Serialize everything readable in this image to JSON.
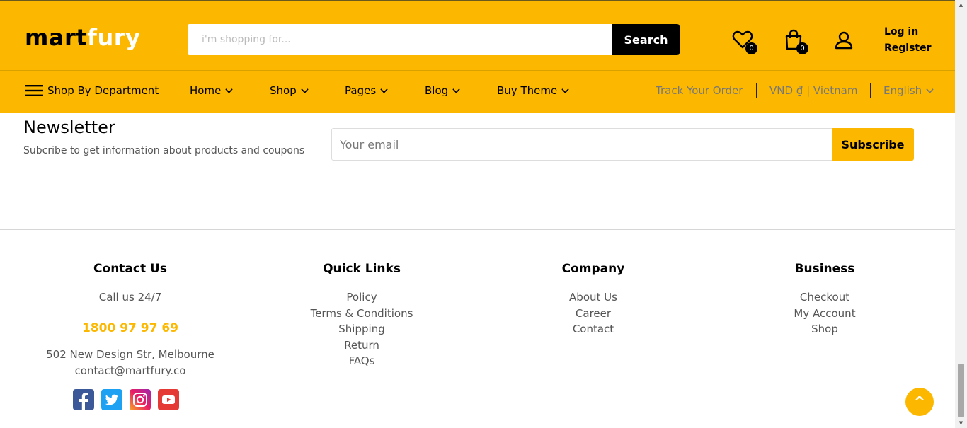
{
  "header": {
    "logo_part1": "mart",
    "logo_part2": "fury",
    "search_placeholder": "i'm shopping for...",
    "search_button": "Search",
    "wishlist_count": "0",
    "cart_count": "0",
    "login": "Log in",
    "register": "Register"
  },
  "nav": {
    "department": "Shop By Department",
    "items": [
      "Home",
      "Shop",
      "Pages",
      "Blog",
      "Buy Theme"
    ],
    "track": "Track Your Order",
    "currency": "VND ₫ | Vietnam",
    "language": "English"
  },
  "newsletter": {
    "title": "Newsletter",
    "subtitle": "Subcribe to get information about products and coupons",
    "email_placeholder": "Your email",
    "button": "Subscribe"
  },
  "footer": {
    "contact": {
      "title": "Contact Us",
      "call": "Call us 24/7",
      "phone": "1800 97 97 69",
      "address": "502 New Design Str, Melbourne",
      "email": "contact@martfury.co"
    },
    "quick_links": {
      "title": "Quick Links",
      "links": [
        "Policy",
        "Terms & Conditions",
        "Shipping",
        "Return",
        "FAQs"
      ]
    },
    "company": {
      "title": "Company",
      "links": [
        "About Us",
        "Career",
        "Contact"
      ]
    },
    "business": {
      "title": "Business",
      "links": [
        "Checkout",
        "My Account",
        "Shop"
      ]
    },
    "social": [
      "facebook-icon",
      "twitter-icon",
      "instagram-icon",
      "youtube-icon"
    ]
  },
  "back_to_top": "^",
  "colors": {
    "brand": "#fcb800",
    "dark": "#000000"
  }
}
